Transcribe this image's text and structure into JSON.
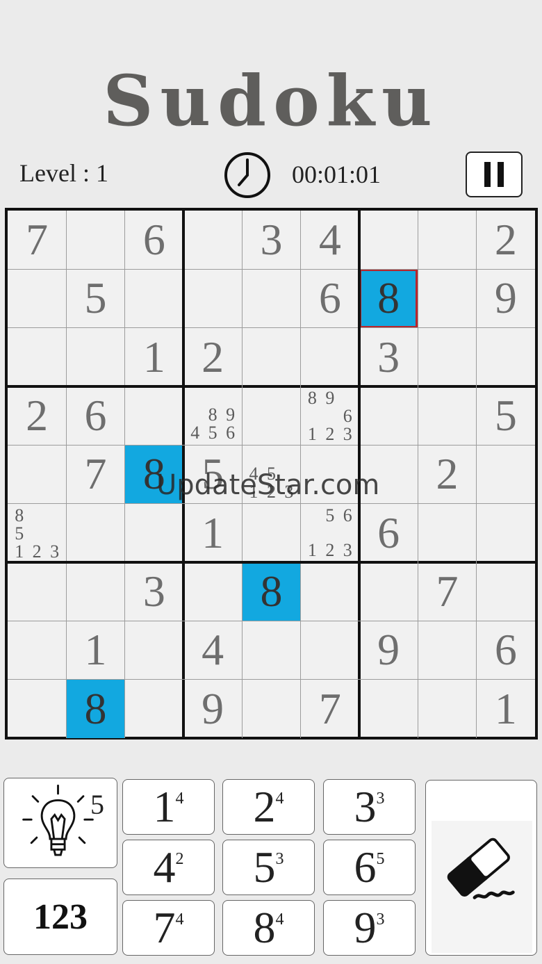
{
  "header": {
    "title": "Sudoku",
    "level_label": "Level : 1",
    "timer": "00:01:01"
  },
  "icons": {
    "clock": "clock-icon",
    "pause": "pause-icon",
    "hint": "lightbulb-icon",
    "eraser": "eraser-icon"
  },
  "colors": {
    "highlight": "#12a8e0",
    "selected_border": "#b8262c",
    "given_digit": "#6e6e6e"
  },
  "board": {
    "rows": [
      [
        "7",
        "",
        "6",
        "",
        "3",
        "4",
        "",
        "",
        "2"
      ],
      [
        "",
        "5",
        "",
        "",
        "",
        "6",
        "8",
        "",
        "9"
      ],
      [
        "",
        "",
        "1",
        "2",
        "",
        "",
        "3",
        "",
        ""
      ],
      [
        "2",
        "6",
        "",
        "",
        "",
        "",
        "",
        "",
        "5"
      ],
      [
        "",
        "7",
        "8",
        "5",
        "",
        "",
        "",
        "2",
        ""
      ],
      [
        "",
        "",
        "",
        "1",
        "",
        "",
        "6",
        "",
        ""
      ],
      [
        "",
        "",
        "3",
        "",
        "8",
        "",
        "",
        "7",
        ""
      ],
      [
        "",
        "1",
        "",
        "4",
        "",
        "",
        "9",
        "",
        "6"
      ],
      [
        "",
        "8",
        "",
        "9",
        "",
        "7",
        "",
        "",
        "1"
      ]
    ],
    "selected": {
      "row": 1,
      "col": 6
    },
    "highlighted": [
      [
        1,
        6
      ],
      [
        4,
        2
      ],
      [
        6,
        4
      ],
      [
        8,
        1
      ]
    ],
    "notes": [
      {
        "row": 3,
        "col": 3,
        "cells": [
          "",
          "",
          "",
          "",
          "8",
          "9",
          "4",
          "5",
          "6"
        ]
      },
      {
        "row": 3,
        "col": 5,
        "cells": [
          "8",
          "9",
          "",
          "",
          "",
          "6",
          "1",
          "2",
          "3"
        ]
      },
      {
        "row": 4,
        "col": 4,
        "cells": [
          "",
          "",
          "",
          "4",
          "5",
          "",
          "1",
          "2",
          "3"
        ]
      },
      {
        "row": 5,
        "col": 0,
        "cells": [
          "8",
          "",
          "",
          "5",
          "",
          "",
          "1",
          "2",
          "3"
        ]
      },
      {
        "row": 5,
        "col": 5,
        "cells": [
          "",
          "5",
          "6",
          "",
          "",
          "",
          "1",
          "2",
          "3"
        ]
      }
    ]
  },
  "watermark": "UpdateStar.com",
  "pad": {
    "hint_count": "5",
    "mode_label": "123",
    "numbers": [
      {
        "digit": "1",
        "count": "4"
      },
      {
        "digit": "2",
        "count": "4"
      },
      {
        "digit": "3",
        "count": "3"
      },
      {
        "digit": "4",
        "count": "2"
      },
      {
        "digit": "5",
        "count": "3"
      },
      {
        "digit": "6",
        "count": "5"
      },
      {
        "digit": "7",
        "count": "4"
      },
      {
        "digit": "8",
        "count": "4"
      },
      {
        "digit": "9",
        "count": "3"
      }
    ]
  }
}
